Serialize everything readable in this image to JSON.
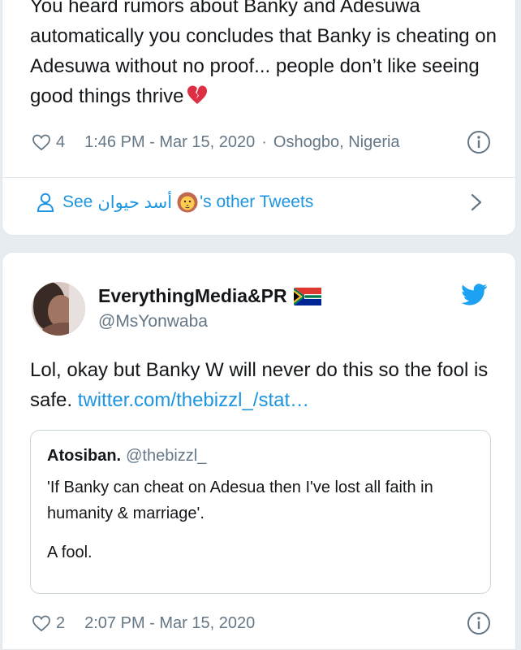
{
  "tweet1": {
    "text": "You heard rumors about Banky and Adesuwa automatically you concludes that Banky is cheating on Adesuwa without no proof... people don’t like seeing good things thrive",
    "emoji_icon": "broken-heart-icon",
    "likes": "4",
    "time": "1:46 PM - Mar 15, 2020",
    "separator": "·",
    "location": "Oshogbo, Nigeria",
    "see_label": "See",
    "author_name": "أسد حيوان",
    "author_emoji_icon": "lion-face-icon",
    "see_suffix": "'s other Tweets"
  },
  "tweet2": {
    "display_name": "EverythingMedia&PR",
    "flag_icon": "south-africa-flag-icon",
    "handle": "@MsYonwaba",
    "text": "Lol, okay but Banky W will never do this so the fool is safe. ",
    "link": "twitter.com/thebizzl_/stat…",
    "likes": "2",
    "time": "2:07 PM - Mar 15, 2020",
    "quote": {
      "name": "Atosiban.",
      "handle": "@thebizzl_",
      "line1": "'If Banky can cheat on Adesua then I've lost all faith in humanity & marriage'.",
      "line2": "A fool."
    }
  },
  "colors": {
    "link_blue": "#1b95e0",
    "text": "#14171a",
    "muted": "#657786",
    "background": "#e6ecf0",
    "border": "#e1e8ed"
  }
}
